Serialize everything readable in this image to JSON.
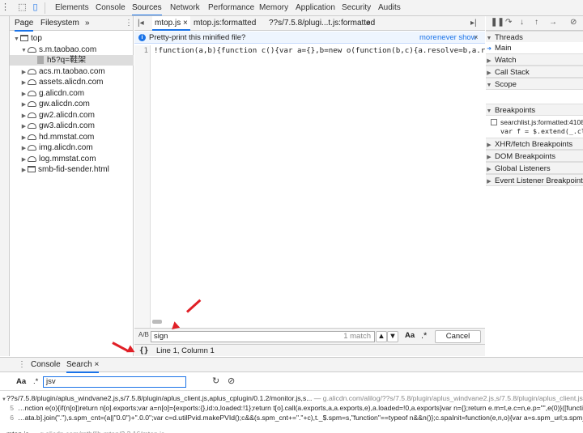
{
  "toolbar": {
    "tabs": [
      "Elements",
      "Console",
      "Sources",
      "Network",
      "Performance",
      "Memory",
      "Application",
      "Security",
      "Audits"
    ],
    "active": "Sources",
    "icons": [
      "inspect-icon",
      "device-icon"
    ]
  },
  "navigator": {
    "tabs": [
      "Page",
      "Filesystem",
      "»"
    ],
    "tree": [
      {
        "label": "top",
        "level": 0,
        "icon": "frame-icon",
        "expanded": true
      },
      {
        "label": "s.m.taobao.com",
        "level": 1,
        "icon": "cloud-icon",
        "expanded": true
      },
      {
        "label": "h5?q=鞋架",
        "level": 2,
        "icon": "file-icon",
        "selected": true
      },
      {
        "label": "acs.m.taobao.com",
        "level": 1,
        "icon": "cloud-icon"
      },
      {
        "label": "assets.alicdn.com",
        "level": 1,
        "icon": "cloud-icon"
      },
      {
        "label": "g.alicdn.com",
        "level": 1,
        "icon": "cloud-icon"
      },
      {
        "label": "gw.alicdn.com",
        "level": 1,
        "icon": "cloud-icon"
      },
      {
        "label": "gw2.alicdn.com",
        "level": 1,
        "icon": "cloud-icon"
      },
      {
        "label": "gw3.alicdn.com",
        "level": 1,
        "icon": "cloud-icon"
      },
      {
        "label": "hd.mmstat.com",
        "level": 1,
        "icon": "cloud-icon"
      },
      {
        "label": "img.alicdn.com",
        "level": 1,
        "icon": "cloud-icon"
      },
      {
        "label": "log.mmstat.com",
        "level": 1,
        "icon": "cloud-icon"
      },
      {
        "label": "smb-fid-sender.html",
        "level": 1,
        "icon": "frame-icon"
      }
    ]
  },
  "editor": {
    "tabs": [
      "mtop.js ×",
      "mtop.js:formatted",
      "??s/7.5.8/plugi...t.js:formatted",
      "»"
    ],
    "info": {
      "text": "Pretty-print this minified file?",
      "more": "more",
      "never": "never show",
      "close": "×"
    },
    "line_number": "1",
    "code": "!function(a,b){function c(){var a={},b=new o(function(b,c){a.resolve=b,a.reject=c})",
    "find": {
      "value": "sign",
      "count": "1 match",
      "case": "Aa",
      "regex": ".*",
      "cancel": "Cancel",
      "icon": "A/B"
    },
    "status": {
      "braces": "{}",
      "position": "Line 1, Column 1"
    }
  },
  "debugger": {
    "sections": [
      {
        "label": "Threads",
        "expanded": true
      },
      {
        "label": "Main",
        "item": true
      },
      {
        "label": "Watch"
      },
      {
        "label": "Call Stack"
      },
      {
        "label": "Scope",
        "expanded": true
      },
      {
        "label": "Breakpoints",
        "expanded": true
      },
      {
        "label": "XHR/fetch Breakpoints"
      },
      {
        "label": "DOM Breakpoints"
      },
      {
        "label": "Global Listeners"
      },
      {
        "label": "Event Listener Breakpoints"
      }
    ],
    "breakpoint": {
      "file": "searchlist.js:formatted:4108",
      "code": "var f = $.extend(_.cl"
    }
  },
  "drawer": {
    "tabs": [
      "Console",
      "Search ×"
    ],
    "search_value": "jsv",
    "case_label": "Aa",
    "regex_label": ".*",
    "results": [
      {
        "kind": "file",
        "text": "??s/7.5.8/plugin/aplus_windvane2.js,s/7.5.8/plugin/aplus_client.js,aplus_cplugin/0.1.2/monitor.js,s...",
        "url": " — g.alicdn.com/alilog/??s/7.5.8/plugin/aplus_windvane2.js,s/7.5.8/plugin/aplus_client.js,ap"
      },
      {
        "kind": "line",
        "num": "5",
        "text": "…nction e(o){if(n[o])return n[o].exports;var a=n[o]={exports:{},id:o,loaded:!1};return t[o].call(a.exports,a,a.exports,e),a.loaded=!0,a.exports}var n={};return e.m=t,e.c=n,e.p=\"\",e(0)}([function(t,e,"
      },
      {
        "kind": "line",
        "num": "6",
        "text": "…ata.b].join(\".\"),s.spm_cnt=(a||\"0.0\")+\".0.0\";var c=d.utilPvid.makePVId();c&&(s.spm_cnt+=\".\"+c),t._$.spm=s,\"function\"==typeof n&&n()};c.spaInit=function(e,n,o){var a=s.spm_url;s.spm_pre="
      },
      {
        "kind": "file",
        "text": "mtop.js",
        "url": " — g.alicdn.com/mtb/lib-mtop/2.3.16/mtop.js"
      }
    ]
  },
  "colors": {
    "accent": "#1a73e8",
    "arrow": "#e01f26"
  }
}
